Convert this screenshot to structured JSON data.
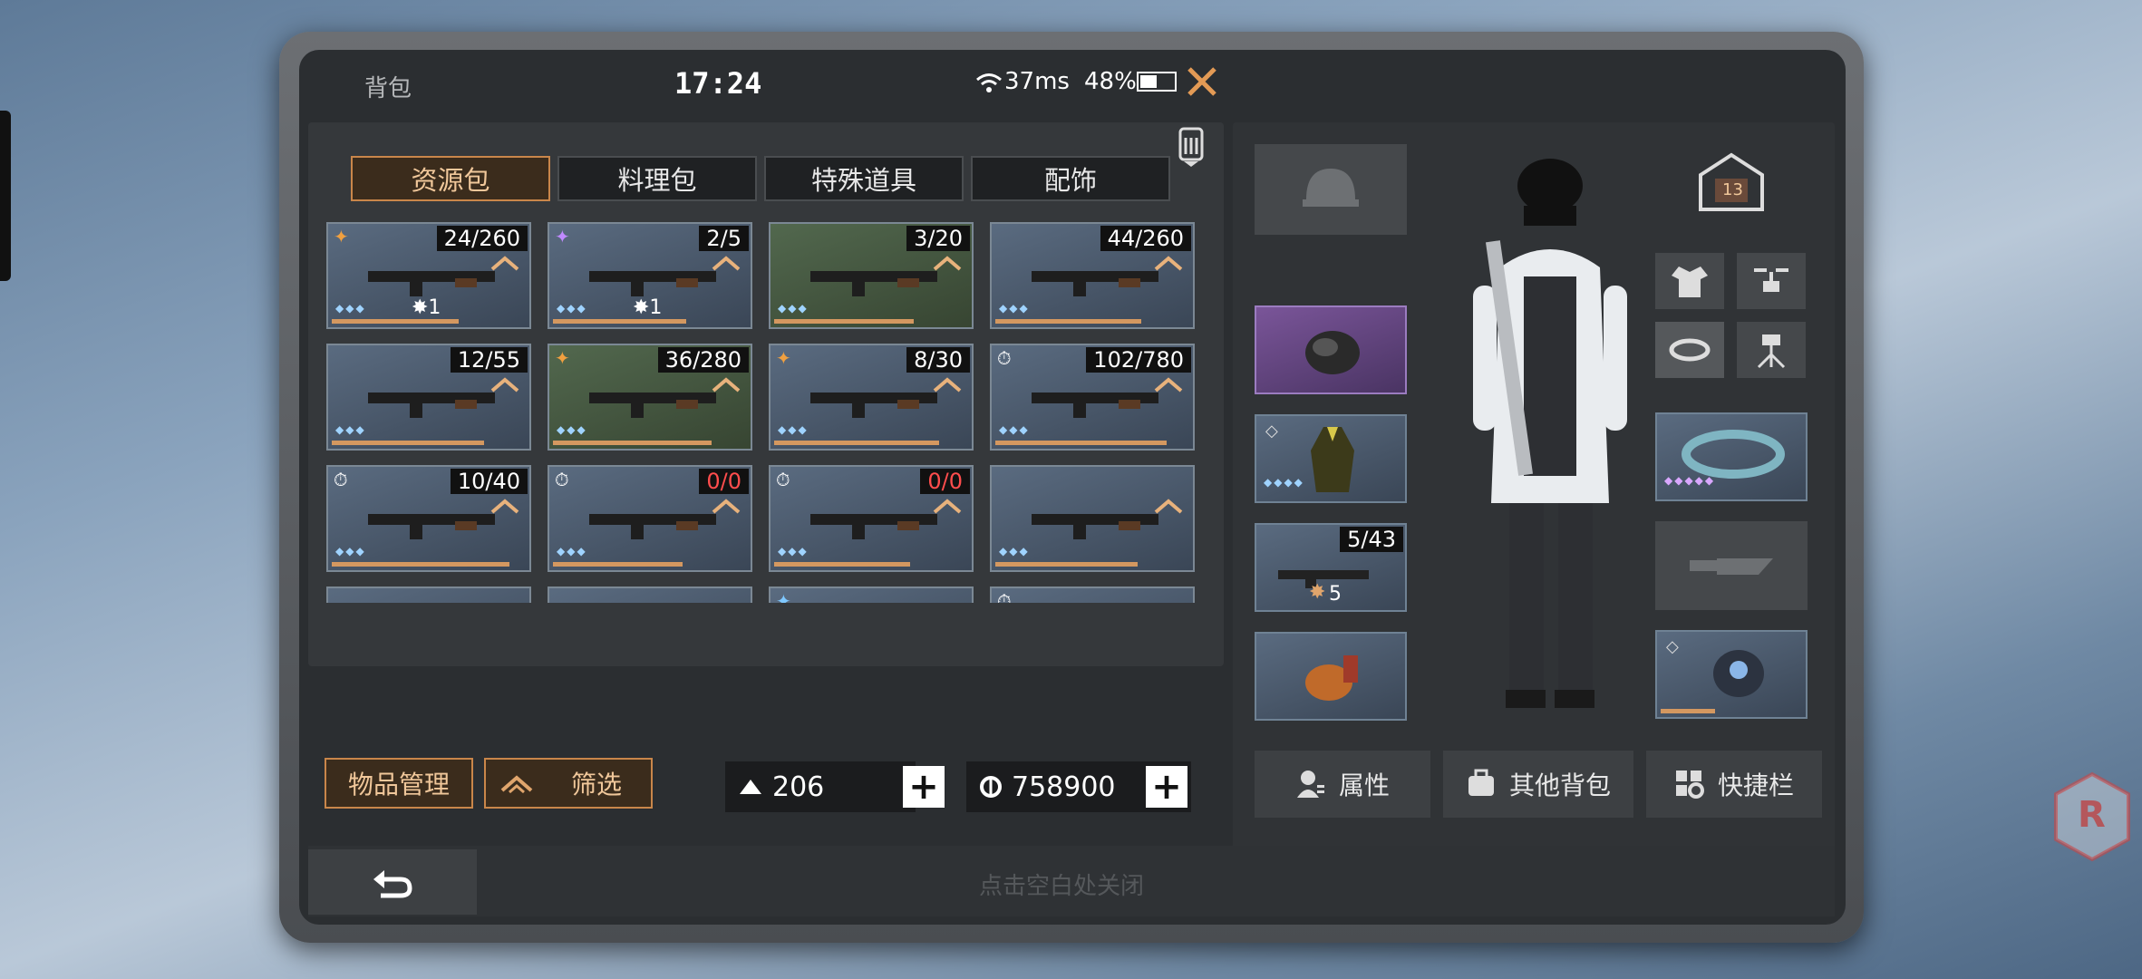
{
  "topbar": {
    "title": "背包",
    "time": "17:24",
    "ping": "37ms",
    "battery": "48%"
  },
  "tabs": [
    {
      "label": "资源包",
      "active": true
    },
    {
      "label": "料理包",
      "active": false
    },
    {
      "label": "特殊道具",
      "active": false
    },
    {
      "label": "配饰",
      "active": false
    }
  ],
  "grid": [
    {
      "count": "24/260",
      "level": "1",
      "tier": "fire",
      "color": "blue"
    },
    {
      "count": "2/5",
      "level": "1",
      "tier": "purple",
      "color": "blue"
    },
    {
      "count": "3/20",
      "level": "",
      "tier": "",
      "color": "green"
    },
    {
      "count": "44/260",
      "level": "",
      "tier": "",
      "color": "blue"
    },
    {
      "count": "12/55",
      "level": "",
      "tier": "",
      "color": "blue"
    },
    {
      "count": "36/280",
      "level": "",
      "tier": "fire",
      "color": "green"
    },
    {
      "count": "8/30",
      "level": "",
      "tier": "sun",
      "color": "blue"
    },
    {
      "count": "102/780",
      "level": "",
      "tier": "timer",
      "color": "blue"
    },
    {
      "count": "10/40",
      "level": "",
      "tier": "timer",
      "color": "blue"
    },
    {
      "count": "0/0",
      "level": "",
      "tier": "timer",
      "color": "blue"
    },
    {
      "count": "0/0",
      "level": "",
      "tier": "timer",
      "color": "blue"
    },
    {
      "count": "",
      "level": "",
      "tier": "",
      "color": "blue"
    },
    {
      "count": "",
      "level": "",
      "tier": "",
      "color": "blue"
    },
    {
      "count": "",
      "level": "",
      "tier": "",
      "color": "blue"
    },
    {
      "count": "",
      "level": "",
      "tier": "blue",
      "color": "blue"
    },
    {
      "count": "",
      "level": "",
      "tier": "timer",
      "color": "blue"
    }
  ],
  "buttons": {
    "manage": "物品管理",
    "filter": "筛选"
  },
  "currency": {
    "resources": "206",
    "gold": "758900"
  },
  "equipment": {
    "ammo_count": "5/43",
    "ammo_level": "5",
    "house_level": "13"
  },
  "bottom_buttons": {
    "attributes": "属性",
    "other_bags": "其他背包",
    "quickbar": "快捷栏"
  },
  "footer_hint": "点击空白处关闭",
  "watermark": "R",
  "colors": {
    "accent": "#c9864a",
    "panel": "#35383b",
    "red_count": "#ff4d4d"
  }
}
